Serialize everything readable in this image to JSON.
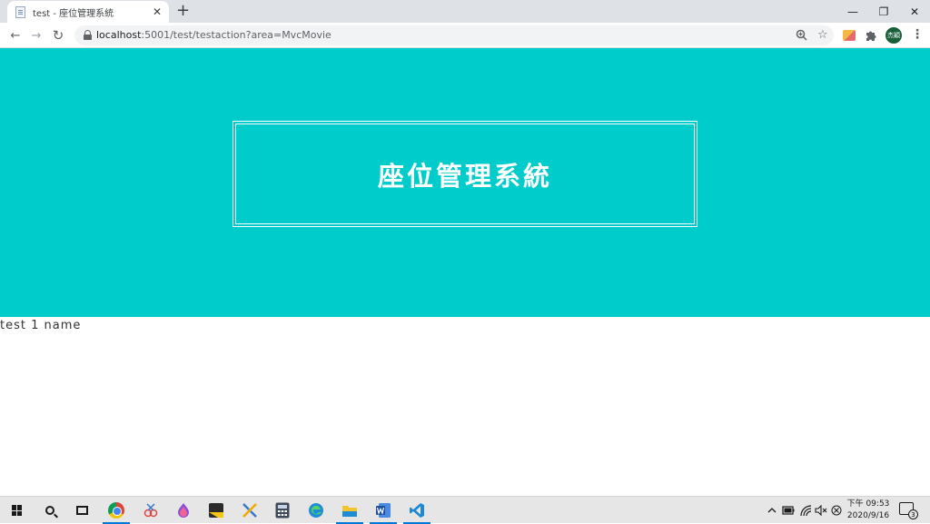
{
  "browser": {
    "tab": {
      "title": "test - 座位管理系統",
      "close": "✕"
    },
    "new_tab": "+",
    "window_controls": {
      "minimize": "—",
      "restore": "❐",
      "close": "✕"
    },
    "nav": {
      "back": "←",
      "forward": "→",
      "reload": "↻"
    },
    "address": {
      "host": "localhost",
      "rest": ":5001/test/testaction?area=MvcMovie"
    },
    "avatar_text": "杰穎",
    "menu": "⋮"
  },
  "page": {
    "hero_title": "座位管理系統",
    "content": "test 1 name"
  },
  "colors": {
    "hero_background": "#00cccc",
    "accent": "#0078d7"
  },
  "taskbar": {
    "apps": [
      "start",
      "search",
      "task-view",
      "chrome",
      "snipping-tool",
      "paint-3d",
      "sticky-notes",
      "tool-app",
      "calculator",
      "edge",
      "file-explorer",
      "word",
      "vscode"
    ],
    "clock": {
      "time": "下午 09:53",
      "date": "2020/9/16"
    },
    "notification_count": "3"
  }
}
